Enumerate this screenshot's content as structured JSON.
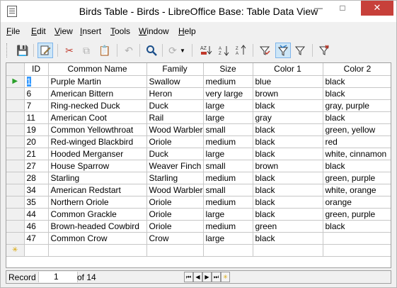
{
  "window": {
    "title": "Birds Table - Birds - LibreOffice Base: Table Data View",
    "minimize": "—",
    "maximize": "□",
    "close": "✕"
  },
  "menu": {
    "items": [
      {
        "mnemonic": "F",
        "rest": "ile"
      },
      {
        "mnemonic": "E",
        "rest": "dit"
      },
      {
        "mnemonic": "V",
        "rest": "iew"
      },
      {
        "mnemonic": "I",
        "rest": "nsert"
      },
      {
        "mnemonic": "T",
        "rest": "ools"
      },
      {
        "mnemonic": "W",
        "rest": "indow"
      },
      {
        "mnemonic": "H",
        "rest": "elp"
      }
    ]
  },
  "toolbar": {
    "icons": [
      "save-icon",
      "edit-data-icon",
      "cut-icon",
      "copy-icon",
      "paste-icon",
      "undo-icon",
      "find-icon",
      "refresh-icon",
      "refresh-dropdown-icon",
      "sort-icon",
      "sort-ascending-icon",
      "sort-descending-icon",
      "autofilter-icon",
      "apply-filter-icon",
      "standard-filter-icon",
      "reset-filter-icon"
    ]
  },
  "grid": {
    "columns": [
      "ID",
      "Common Name",
      "Family",
      "Size",
      "Color 1",
      "Color 2"
    ],
    "rows": [
      [
        "1",
        "Purple Martin",
        "Swallow",
        "medium",
        "blue",
        "black"
      ],
      [
        "6",
        "American Bittern",
        "Heron",
        "very large",
        "brown",
        "black"
      ],
      [
        "7",
        "Ring-necked Duck",
        "Duck",
        "large",
        "black",
        "gray, purple"
      ],
      [
        "11",
        "American Coot",
        "Rail",
        "large",
        "gray",
        "black"
      ],
      [
        "19",
        "Common Yellowthroat",
        "Wood Warbler",
        "small",
        "black",
        "green, yellow"
      ],
      [
        "20",
        "Red-winged Blackbird",
        "Oriole",
        "medium",
        "black",
        "red"
      ],
      [
        "21",
        "Hooded Merganser",
        "Duck",
        "large",
        "black",
        "white, cinnamon"
      ],
      [
        "27",
        "House Sparrow",
        "Weaver Finch",
        "small",
        "brown",
        "black"
      ],
      [
        "28",
        "Starling",
        "Starling",
        "medium",
        "black",
        "green, purple"
      ],
      [
        "34",
        "American Redstart",
        "Wood Warbler",
        "small",
        "black",
        "white, orange"
      ],
      [
        "35",
        "Northern Oriole",
        "Oriole",
        "medium",
        "black",
        "orange"
      ],
      [
        "44",
        "Common Grackle",
        "Oriole",
        "large",
        "black",
        "green, purple"
      ],
      [
        "46",
        "Brown-headed Cowbird",
        "Oriole",
        "medium",
        "green",
        "black"
      ],
      [
        "47",
        "Common Crow",
        "Crow",
        "large",
        "black",
        ""
      ]
    ],
    "current_row_marker": "▶",
    "new_row_marker": "✳"
  },
  "navigator": {
    "label": "Record",
    "current": "1",
    "of_text": "of 14",
    "buttons": [
      "⏮",
      "◀",
      "▶",
      "⏭",
      "✳"
    ]
  },
  "colors": {
    "selection": "#3399ff",
    "close_button": "#c7403a",
    "active_tool": "#cde6f7"
  }
}
